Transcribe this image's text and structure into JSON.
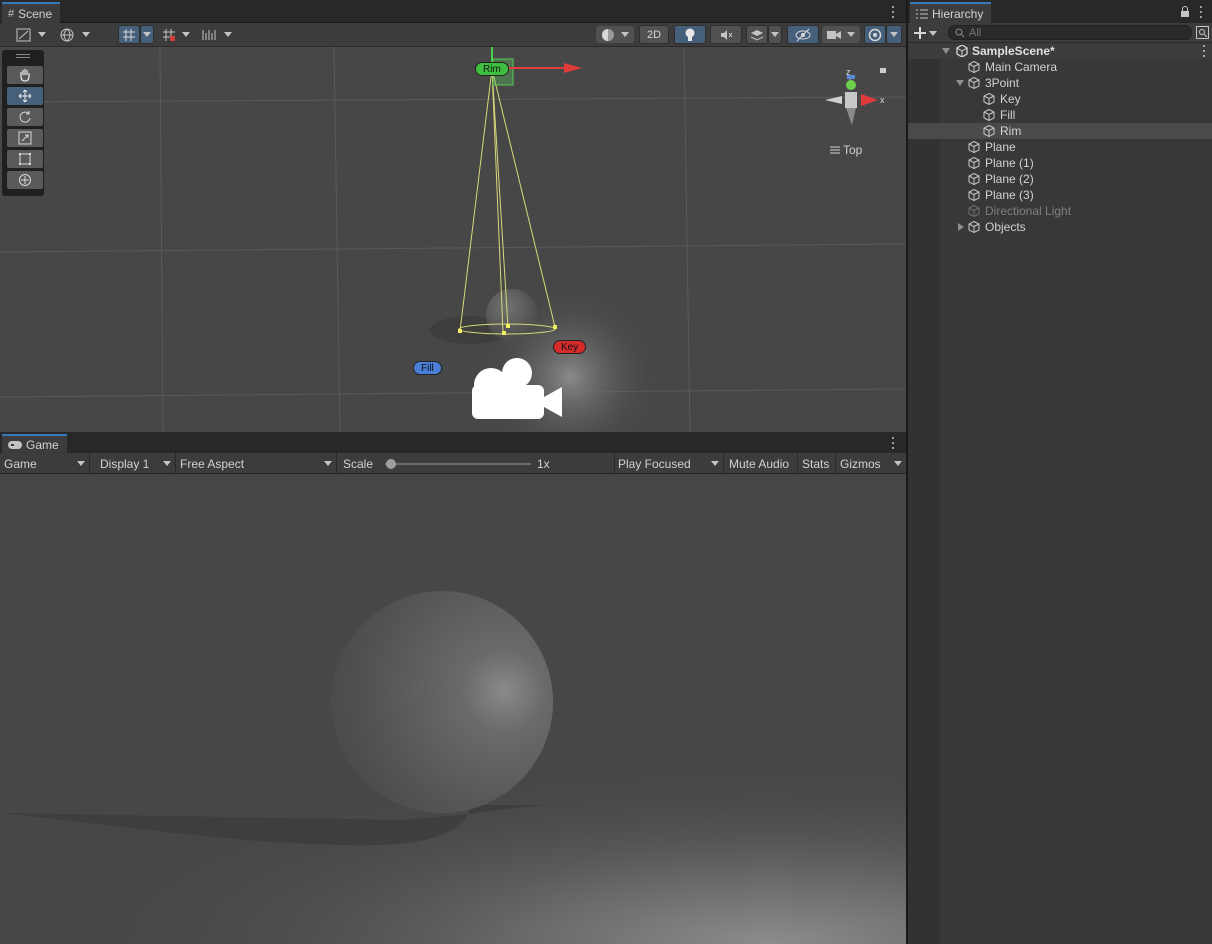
{
  "scene": {
    "tab_label": "Scene",
    "btn_2d": "2D",
    "view_label": "Top",
    "labels": {
      "rim": "Rim",
      "key": "Key",
      "fill": "Fill"
    },
    "axis_x": "x",
    "axis_z": "z"
  },
  "game": {
    "tab_label": "Game",
    "mode": "Game",
    "display": "Display 1",
    "aspect": "Free Aspect",
    "scale_label": "Scale",
    "scale_value": "1x",
    "scale_slider_fraction": 0.02,
    "play_mode": "Play Focused",
    "mute": "Mute Audio",
    "stats": "Stats",
    "gizmos": "Gizmos"
  },
  "hierarchy": {
    "tab_label": "Hierarchy",
    "search_placeholder": "All",
    "scene_name": "SampleScene*",
    "items": [
      {
        "label": "Main Camera"
      },
      {
        "label": "3Point"
      },
      {
        "label": "Key"
      },
      {
        "label": "Fill"
      },
      {
        "label": "Rim"
      },
      {
        "label": "Plane"
      },
      {
        "label": "Plane (1)"
      },
      {
        "label": "Plane (2)"
      },
      {
        "label": "Plane (3)"
      },
      {
        "label": "Directional Light"
      },
      {
        "label": "Objects"
      }
    ]
  },
  "colors": {
    "accent": "#3a79bb",
    "selected_row": "#4a4a4a",
    "rim_label": "#3fbf3f",
    "key_label": "#d62b2b",
    "fill_label": "#4a7fd8"
  }
}
